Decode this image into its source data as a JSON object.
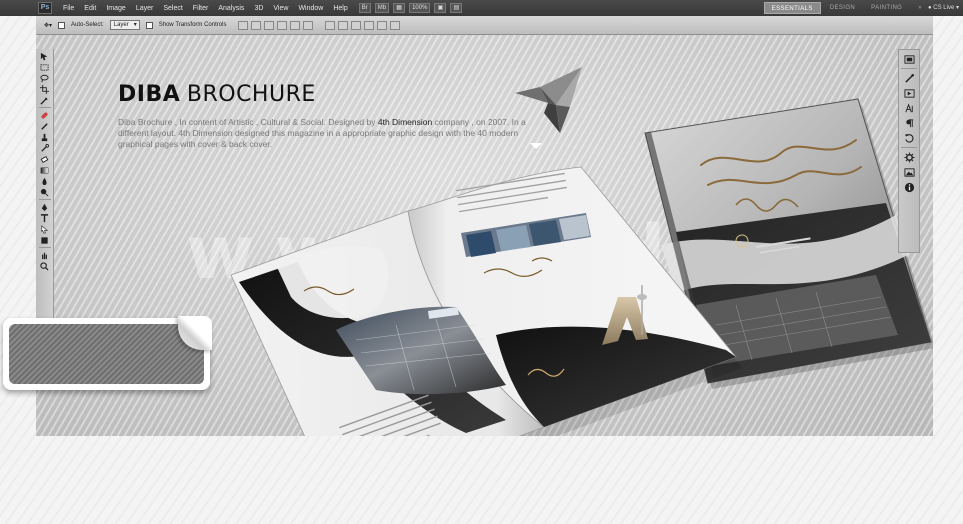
{
  "menubar": {
    "logo": "Ps",
    "items": [
      "File",
      "Edit",
      "Image",
      "Layer",
      "Select",
      "Filter",
      "Analysis",
      "3D",
      "View",
      "Window",
      "Help"
    ],
    "zoom": "100%",
    "workspaces": [
      "ESSENTIALS",
      "DESIGN",
      "PAINTING"
    ],
    "overflow": "»",
    "cs_live": "CS Live"
  },
  "options_bar": {
    "auto_select_label": "Auto-Select:",
    "auto_select_value": "Layer",
    "transform_label": "Show Transform Controls"
  },
  "content": {
    "title_bold": "DIBA",
    "title_rest": "BROCHURE",
    "desc_part1": "Diba Brochure , In content of Artistic , Cultural & Social. Designed by ",
    "desc_highlight": "4th Dimension",
    "desc_part2": " company , on 2007. In a different layout. 4th Dimension designed this magazine in a appropriate graphic design with the 40 modern graphical pages with cover & back cover.",
    "watermark": "www.dldl.ir"
  },
  "colors": {
    "menubar_bg": "#3f3f3f",
    "canvas_bg": "#d4d4d4",
    "title": "#111111",
    "description": "#7a7a7a"
  },
  "icons": {
    "toolbox": [
      "move-icon",
      "marquee-icon",
      "lasso-icon",
      "crop-icon",
      "eyedropper-icon",
      "healing-icon",
      "brush-icon",
      "clone-icon",
      "history-brush-icon",
      "eraser-icon",
      "gradient-icon",
      "blur-icon",
      "dodge-icon",
      "pen-icon",
      "type-icon",
      "path-select-icon",
      "shape-icon",
      "hand-icon",
      "zoom-icon"
    ],
    "dock": [
      "layers-icon",
      "brushes-icon",
      "actions-icon",
      "character-icon",
      "paragraph-icon",
      "history-icon",
      "settings-icon",
      "image-icon",
      "info-icon"
    ]
  }
}
